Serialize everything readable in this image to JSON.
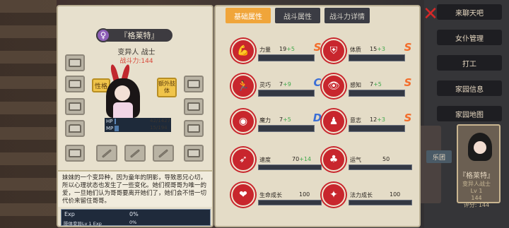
{
  "side_menu": [
    "来聊天吧",
    "女仆管理",
    "打工",
    "家园信息",
    "家园地图"
  ],
  "side_button": "乐团",
  "side_card": {
    "name": "『格莱特』",
    "sub1": "变异人战士",
    "sub2": "Lv 1",
    "sub3": "144",
    "sub4": "评分: 144"
  },
  "profile": {
    "name": "『格莱特』",
    "gender_symbol": "♀",
    "class_line": "变异人 战士",
    "power_line": "战斗力:144",
    "trait_label": "性格",
    "extra_label": "额外肢体",
    "hp_label": "HP",
    "mp_label": "MP",
    "hp_value": "42/1427",
    "mp_value": "15/194",
    "hp_fraction": 0.03,
    "mp_fraction": 0.08,
    "description": "妹妹的一个变异种，因为童年的阴影，导致恶兄心切，所以心理状态也发生了一些变化。她们视哥哥为唯一的爱，一旦她们认为哥哥要离开她们了，她们会不惜一切代价来留住哥哥。",
    "exp_label": "Exp",
    "exp_pct": "0%",
    "exp2_label": "肢体变异Lv 1  Exp",
    "exp2_pct": "0%"
  },
  "tabs": [
    "基础属性",
    "战斗属性",
    "战斗力详情"
  ],
  "close_symbol": "✕",
  "attributes": [
    {
      "label": "力量",
      "base": "19",
      "plus": "+5",
      "grade": "S",
      "icon": "muscle-icon",
      "glyph": "💪"
    },
    {
      "label": "体质",
      "base": "15",
      "plus": "+3",
      "grade": "S",
      "icon": "armor-icon",
      "glyph": "⛨"
    },
    {
      "label": "灵巧",
      "base": "7",
      "plus": "+9",
      "grade": "C",
      "icon": "runner-icon",
      "glyph": "🏃"
    },
    {
      "label": "感知",
      "base": "7",
      "plus": "+5",
      "grade": "S",
      "icon": "eye-icon",
      "glyph": "👁"
    },
    {
      "label": "魔力",
      "base": "7",
      "plus": "+5",
      "grade": "D",
      "icon": "magic-icon",
      "glyph": "◉"
    },
    {
      "label": "意志",
      "base": "12",
      "plus": "+3",
      "grade": "S",
      "icon": "will-icon",
      "glyph": "♟"
    }
  ],
  "secondary": [
    {
      "label": "速度",
      "base": "70",
      "plus": "+14",
      "icon": "speed-icon",
      "glyph": "➶"
    },
    {
      "label": "运气",
      "base": "50",
      "plus": "",
      "icon": "clover-icon",
      "glyph": "♣"
    },
    {
      "label": "生命成长",
      "base": "100",
      "plus": "",
      "icon": "heart-growth-icon",
      "glyph": "❤"
    },
    {
      "label": "法力成长",
      "base": "100",
      "plus": "",
      "icon": "star-growth-icon",
      "glyph": "✦"
    }
  ]
}
